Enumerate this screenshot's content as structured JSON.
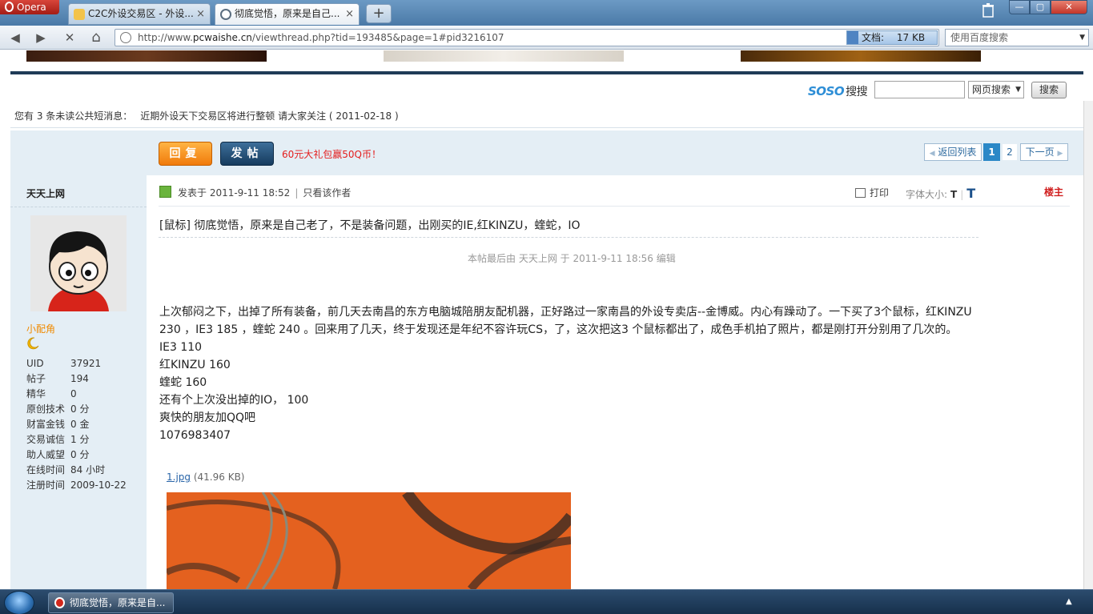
{
  "browser": {
    "brand": "Opera",
    "tabs": [
      {
        "title": "C2C外设交易区 - 外设..."
      },
      {
        "title": "彻底觉悟，原来是自己..."
      }
    ],
    "close_glyph": "×",
    "new_tab_glyph": "+",
    "url_domain": "pcwaishe.cn",
    "url_prefix": "http://www.",
    "url_path": "/viewthread.php?tid=193485&page=1#pid3216107",
    "doc_size_label": "文档:",
    "doc_size": "17 KB",
    "search_placeholder": "使用百度搜索",
    "nav_glyphs": {
      "back": "◀",
      "forward": "▶",
      "stop": "✕",
      "home": "⌂"
    },
    "win_glyphs": {
      "min": "—",
      "max": "▢",
      "close": "✕"
    }
  },
  "page": {
    "soso": {
      "brand": "SOSO",
      "label": "搜搜",
      "select_value": "网页搜索",
      "button": "搜索"
    },
    "pm": {
      "unread": "您有 3 条未读公共短消息：",
      "notice": "近期外设天下交易区将进行整顿 请大家关注 ( 2011-02-18 )"
    },
    "actions": {
      "reply": "回复",
      "post": "发帖",
      "promo": "60元大礼包赢50Q币！"
    },
    "pager": {
      "back": "返回列表",
      "current": "1",
      "page2": "2",
      "next": "下一页"
    },
    "author": {
      "name": "天天上网",
      "group": "小配角",
      "stats": [
        {
          "k": "UID",
          "v": "37921"
        },
        {
          "k": "帖子",
          "v": "194"
        },
        {
          "k": "精华",
          "v": "0"
        },
        {
          "k": "原创技术",
          "v": "0 分"
        },
        {
          "k": "财富金钱",
          "v": "0 金"
        },
        {
          "k": "交易诚信",
          "v": "1 分"
        },
        {
          "k": "助人威望",
          "v": "0 分"
        },
        {
          "k": "在线时间",
          "v": "84 小时"
        },
        {
          "k": "注册时间",
          "v": "2009-10-22"
        }
      ]
    },
    "post": {
      "posted_at": "发表于 2011-9-11 18:52",
      "only_author": "只看该作者",
      "print": "打印",
      "font_size_label": "字体大小:",
      "font_small": "T",
      "font_large": "T",
      "floor": "楼主",
      "title": "[鼠标] 彻底觉悟，原来是自己老了，不是装备问题，出刚买的IE,红KINZU，蝰蛇，IO",
      "edit_note": "本帖最后由 天天上网 于 2011-9-11 18:56 编辑",
      "body": [
        "上次郁闷之下，出掉了所有装备，前几天去南昌的东方电脑城陪朋友配机器，正好路过一家南昌的外设专卖店--金博威。内心有躁动了。一下买了3个鼠标，红KINZU",
        "230  ，IE3  185    ，蝰蛇 240  。回来用了几天，终于发现还是年纪不容许玩CS，了，这次把这3 个鼠标都出了，成色手机拍了照片，都是刚打开分别用了几次的。",
        "IE3 110",
        "红KINZU  160",
        "蝰蛇   160",
        "还有个上次没出掉的IO，  100",
        "爽快的朋友加QQ吧",
        "1076983407"
      ],
      "attachment_name": "1.jpg",
      "attachment_size": "(41.96 KB)"
    }
  },
  "taskbar": {
    "item": "彻底觉悟，原来是自...",
    "tray_glyph": "▲"
  },
  "colors": {
    "accent_orange": "#f07a0b",
    "accent_navy": "#163b5e",
    "promo_red": "#e41d1d",
    "link_blue": "#2864a8"
  }
}
